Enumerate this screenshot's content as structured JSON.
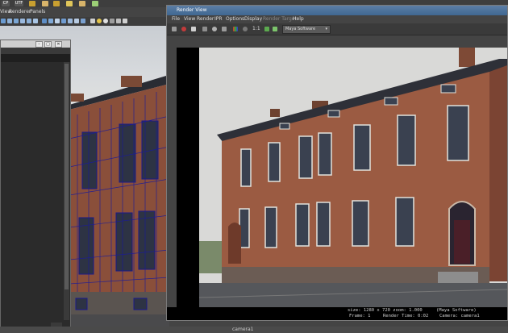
{
  "shelf": {
    "labels": [
      "CP",
      "UTF"
    ],
    "colors": [
      "#c9a030",
      "#8aa7c8",
      "#d8b46a",
      "#9ccf76",
      "#e0c65a",
      "#c8c8c8"
    ]
  },
  "main_menu": {
    "items": [
      "View",
      "Renderer",
      "Panels"
    ]
  },
  "render_view": {
    "title": "Render View",
    "menu": [
      "File",
      "View",
      "Render",
      "IPR",
      "Options",
      "Display",
      "Render Target",
      "Help"
    ],
    "toolbar": {
      "ratio_label": "1:1",
      "renderer_value": "Maya Software"
    },
    "status": {
      "size_line": "size: 1280 x 720  zoom: 1.000",
      "renderer": "(Maya Software)",
      "frame_label": "Frame: 1",
      "render_time": "Render Time: 0:02",
      "camera": "Camera: camera1"
    }
  },
  "viewport": {
    "camera_label": "camera1"
  },
  "outliner": {
    "buttons": [
      "–",
      "□",
      "✕"
    ]
  }
}
